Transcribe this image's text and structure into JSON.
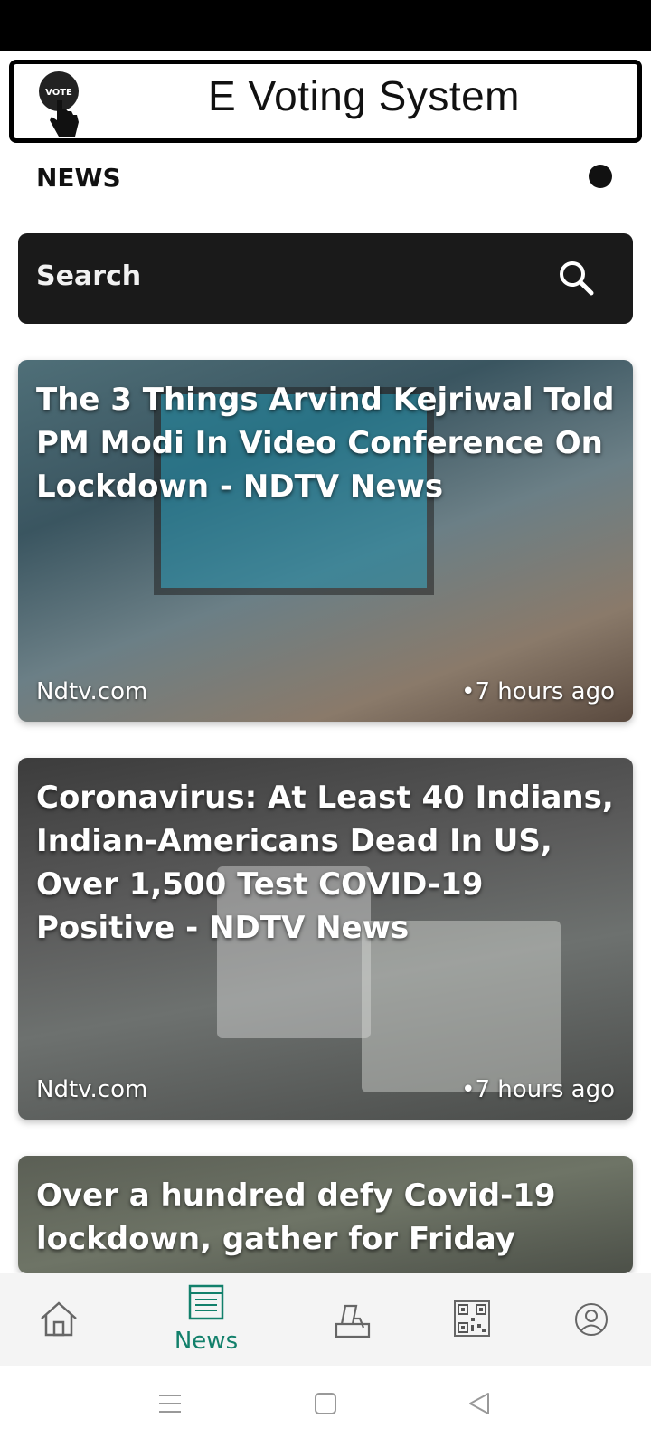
{
  "app": {
    "title": "E Voting System",
    "logo_text": "VOTE"
  },
  "section": {
    "heading": "NEWS"
  },
  "search": {
    "label": "Search"
  },
  "news": [
    {
      "headline": "The 3 Things Arvind Kejriwal Told PM Modi In Video Conference On Lockdown - NDTV News",
      "source": "Ndtv.com",
      "time": "•7 hours ago"
    },
    {
      "headline": "Coronavirus: At Least 40 Indians, Indian-Americans Dead In US, Over 1,500 Test COVID-19 Positive - NDTV News",
      "source": "Ndtv.com",
      "time": "•7 hours ago"
    },
    {
      "headline": "Over a hundred defy Covid-19 lockdown, gather for Friday",
      "source": "",
      "time": ""
    }
  ],
  "bottom_nav": {
    "items": [
      {
        "icon": "home-icon"
      },
      {
        "icon": "news-icon",
        "label": "News",
        "active": true
      },
      {
        "icon": "ballot-icon"
      },
      {
        "icon": "qr-code-icon"
      },
      {
        "icon": "profile-icon"
      }
    ],
    "active_color": "#12806b"
  },
  "system_nav": {
    "icons": [
      "menu-icon",
      "square-icon",
      "back-icon"
    ]
  }
}
